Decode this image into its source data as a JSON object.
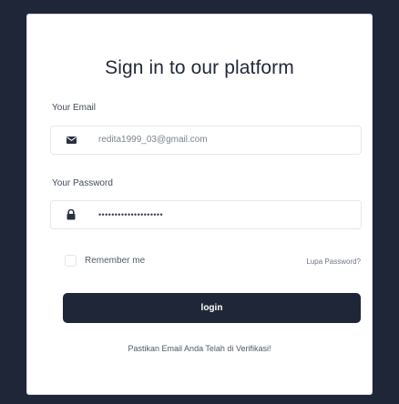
{
  "login": {
    "title": "Sign in to our platform",
    "email_label": "Your Email",
    "email_value": "redita1999_03@gmail.com",
    "email_icon": "envelope-icon",
    "password_label": "Your Password",
    "password_value": "••••••••••••••••••••",
    "password_icon": "lock-icon",
    "remember_label": "Remember me",
    "forgot_label": "Lupa Password?",
    "login_label": "login",
    "note": "Pastikan Email Anda Telah di Verifikasi!"
  },
  "colors": {
    "background": "#1f2637",
    "card": "#ffffff",
    "button": "#1f2637",
    "button_text": "#ffffff",
    "title_text": "#23293a"
  }
}
